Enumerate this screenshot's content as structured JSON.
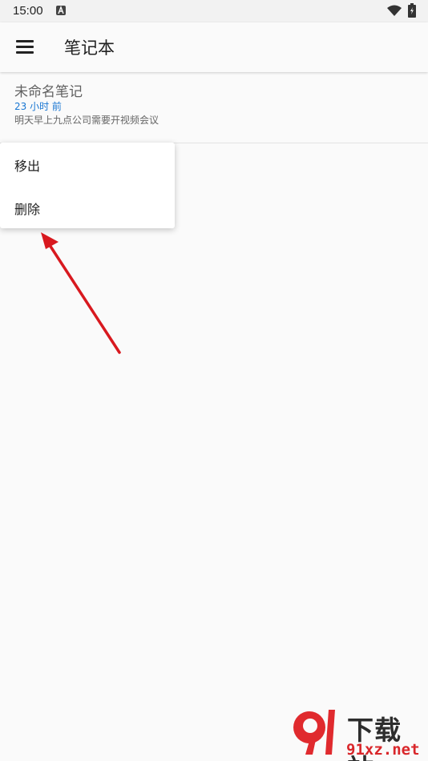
{
  "status_bar": {
    "time": "15:00",
    "notif_icon": "a-icon"
  },
  "app_bar": {
    "title": "笔记本",
    "menu_icon": "hamburger-menu-icon"
  },
  "notes": [
    {
      "title": "未命名笔记",
      "time": "23 小时 前",
      "snippet": "明天早上九点公司需要开视频会议"
    }
  ],
  "context_menu": {
    "items": [
      "移出",
      "删除"
    ]
  },
  "watermark": {
    "brand": "下载站",
    "url": "91xz.net"
  },
  "colors": {
    "accent": "#1976d2",
    "arrow": "#d8191f",
    "background": "#fafafa"
  }
}
